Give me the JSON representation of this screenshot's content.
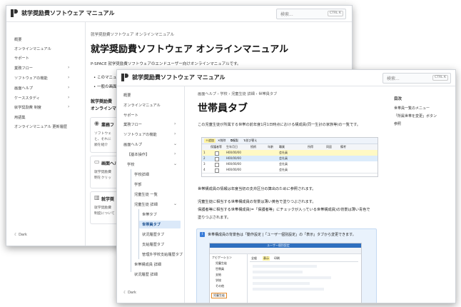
{
  "app": {
    "title": "就学奨励費ソフトウェア マニュアル"
  },
  "search": {
    "placeholder": "検索...",
    "shortcut": "CTRL K"
  },
  "back": {
    "sidebar": [
      "概要",
      "オンラインマニュアル",
      "サポート",
      "業務フロー",
      "ソフトウェアの機能",
      "画面ヘルプ",
      "ケーススタディ",
      "就学奨励費 制度",
      "用語集",
      "オンラインマニュアル 更新履歴"
    ],
    "dark": "Dark",
    "breadcrumb": "就学奨励費ソフトウェア オンラインマニュアル",
    "title": "就学奨励費ソフトウェア オンラインマニュアル",
    "intro": "P-SPACE 就学奨励費ソフトウェアのエンドユーザー向けオンラインマニュアルです。",
    "bullets": [
      "このマニュアル",
      "一般の画面"
    ],
    "section1": "就学奨励費",
    "section2": "オンラインマニュ",
    "card1": {
      "title": "業務フ",
      "l1": "ソフトウェ",
      "l2": "と、それに",
      "l3": "順を紹介"
    },
    "card2": {
      "title": "画面ヘル",
      "l1": "就学奨励費",
      "l2": "明をクリッ"
    },
    "card3": {
      "title": "就学奨",
      "l1": "就学奨励費",
      "l2": "制度について"
    }
  },
  "front": {
    "sidebar": {
      "items": [
        "概要",
        "オンラインマニュアル",
        "サポート",
        "業務フロー",
        "ソフトウェアの機能",
        "画面ヘルプ",
        "【基本操作】",
        "学校",
        "学校詳細",
        "学部",
        "児童生徒 一覧",
        "児童生徒 詳細",
        "世帯タブ",
        "世帯員タブ",
        "状況履歴タブ",
        "支給履歴タブ",
        "管理外学校支給履歴タブ",
        "世帯構成員 詳細",
        "状況履歴 詳細"
      ],
      "dark": "Dark"
    },
    "breadcrumb": [
      "画面ヘルプ",
      "学校",
      "児童生徒 詳細",
      "世帯員タブ"
    ],
    "page_title": "世帯員タブ",
    "intro": "この児童生徒が所属する世帯の前年度1月1日時点における構成員(同一生計の家族等)の一覧です。",
    "para1": "世帯構成員の情報は年度当初の支弁区分の算出のために参照されます。",
    "para2": "児童生徒に相当する世帯構成員の背景は薄い黄色で塗りつぶされます。",
    "para3a": "保護者等に相当する世帯構成員(=「保護者等」にチェックが入っている世帯構成員)の背景は薄い青色で",
    "para3b": "塗りつぶされます。",
    "note": {
      "text": "世帯構成員の背景色は「動作設定 |「ユーザー個別設定」の「表示」タブから変更できます。",
      "icon": "i"
    },
    "toc": {
      "title": "目次",
      "items": [
        "世帯員一覧のメニュー",
        "「所属世帯を変更」ボタン",
        "参照"
      ]
    },
    "table": {
      "toolbar": [
        "追加",
        "削除",
        "複製",
        "並び替え"
      ],
      "headers": [
        "",
        "保護者等",
        "生年月日",
        "続柄",
        "年齢",
        "職業",
        "所得",
        "同居",
        "備考"
      ],
      "rows": [
        [
          "1",
          "",
          "H00/00/00",
          "",
          "",
          "会社員",
          "",
          "",
          ""
        ],
        [
          "2",
          "",
          "H00/00/00",
          "",
          "",
          "会社員",
          "",
          "",
          ""
        ],
        [
          "3",
          "",
          "H00/00/00",
          "",
          "",
          "会社員",
          "",
          "",
          ""
        ],
        [
          "4",
          "",
          "H00/00/00",
          "",
          "",
          "会社員",
          "",
          "",
          ""
        ]
      ]
    },
    "shot2": {
      "title": "ユーザー個別設定",
      "tabs": [
        "全般",
        "表示",
        "印刷"
      ],
      "tree": [
        "ナビゲーション",
        "児童生徒",
        "世帯員",
        "支給",
        "学校",
        "その他"
      ],
      "selected": "児童生徒"
    }
  },
  "colors": {
    "accent": "#1a73e8",
    "highlight": "#dbe9f9",
    "yellow_row": "#fff9c4",
    "blue_row": "#dcecfb"
  }
}
